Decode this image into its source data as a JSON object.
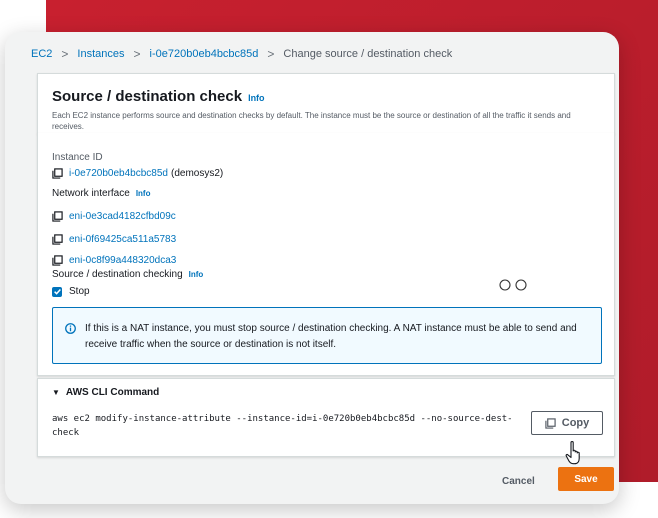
{
  "colors": {
    "accent_link": "#0073bb",
    "primary_button": "#ec7211",
    "background_card": "#c8202f"
  },
  "breadcrumb": {
    "items": [
      "EC2",
      "Instances",
      "i-0e720b0eb4bcbc85d"
    ],
    "current": "Change source / destination check"
  },
  "header": {
    "title": "Source / destination check",
    "info": "Info",
    "description": "Each EC2 instance performs source and destination checks by default. The instance must be the source or destination of all the traffic it sends and receives."
  },
  "instance": {
    "label": "Instance ID",
    "id": "i-0e720b0eb4bcbc85d",
    "name": "(demosys2)"
  },
  "network_interface": {
    "label": "Network interface",
    "info": "Info",
    "enis": [
      "eni-0e3cad4182cfbd09c",
      "eni-0f69425ca511a5783",
      "eni-0c8f99a448320dca3"
    ]
  },
  "checking": {
    "label": "Source / destination checking",
    "info": "Info",
    "checkbox_label": "Stop",
    "checked": true
  },
  "alert": {
    "text": "If this is a NAT instance, you must stop source / destination checking. A NAT instance must be able to send and receive traffic when the source or destination is not itself."
  },
  "cli": {
    "title": "AWS CLI Command",
    "command": "aws ec2 modify-instance-attribute --instance-id=i-0e720b0eb4bcbc85d --no-source-dest-check",
    "copy_label": "Copy"
  },
  "footer": {
    "cancel_label": "Cancel",
    "save_label": "Save"
  },
  "icons": {
    "copy": "copy-icon",
    "info": "info-circle-icon",
    "check": "checkmark-icon",
    "expand": "caret-down-icon",
    "cursor": "hand-pointer-icon"
  }
}
